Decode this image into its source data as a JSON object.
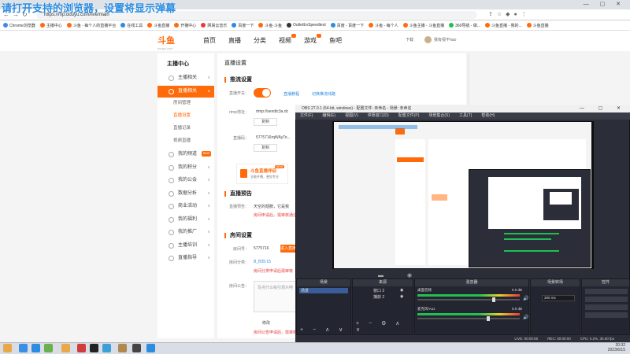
{
  "overlay": {
    "title": "请打开支持的浏览器，设置将显示弹幕"
  },
  "browser": {
    "url": "https://mp.douyu.com/live/main",
    "bookmarks": [
      "Chrome浏览器",
      "主播中心",
      "斗鱼 - 每个人的直播平台",
      "在线工具",
      "斗鱼直播",
      "开播中心",
      "网易云音乐",
      "百度一下",
      "斗鱼·斗鱼",
      "OutletEvSpeedtest",
      "百度 - 百度一下",
      "斗鱼 - 每个人",
      "斗鱼主播 - 斗鱼直播",
      "360导航 - 做...",
      "斗鱼直播 - 我的...",
      "斗鱼直播"
    ],
    "bookmark_colors": [
      "#4285f4",
      "#ff6b0a",
      "#ff6b0a",
      "#2b8ce0",
      "#ff6b0a",
      "#ff6b0a",
      "#e83b3b",
      "#2b8ce0",
      "#ff6b0a",
      "#333333",
      "#2b8ce0",
      "#ff6b0a",
      "#ff6b0a",
      "#1fc152",
      "#ff6b0a",
      "#ff6b0a"
    ]
  },
  "site": {
    "logo": "斗鱼",
    "logo_sub": "douyu.com",
    "nav": [
      "首页",
      "直播",
      "分类",
      "视频",
      "游戏",
      "鱼吧"
    ],
    "download": "下载",
    "username": "我有视不hao"
  },
  "sidebar": {
    "title": "主播中心",
    "items": [
      {
        "label": "主播相关"
      },
      {
        "label": "直播相关",
        "active": true
      },
      {
        "label": "我的频道"
      },
      {
        "label": "我的积分"
      },
      {
        "label": "我的公会"
      },
      {
        "label": "数据分析"
      },
      {
        "label": "商业活动"
      },
      {
        "label": "我的福利"
      },
      {
        "label": "我的推广"
      },
      {
        "label": "主播培训"
      },
      {
        "label": "直播指导"
      }
    ],
    "subitems": [
      "房间管理",
      "直播设置",
      "直播记录",
      "视频直播"
    ],
    "badge": "NEW"
  },
  "content": {
    "title": "直播设置",
    "push": {
      "section": "推流设置",
      "switch_label": "直播开关：",
      "help_link": "直播教程",
      "link2": "切换推流线路",
      "rtmp_label": "rtmp地址：",
      "rtmp_value": "rtmp://sendtc3a.dc",
      "code_label": "直播码：",
      "code_value": "5775716rqWAyTo...",
      "copy": "复制"
    },
    "promo": {
      "title": "斗鱼直播伴侣",
      "sub": "全能开播，更加专业",
      "badge": "NEW"
    },
    "notice": {
      "section": "直播预告",
      "label": "直播预告：",
      "value": "天空的翅膀，它是我",
      "warn": "房间申请后，需审核通过"
    },
    "room": {
      "section": "房间设置",
      "id_label": "房间号：",
      "id_value": "5775716",
      "enter": "进入直播间",
      "cat_label": "房间分类：",
      "cat_value": "B_B35:15",
      "cat_warn": "房间分类申请后需审核",
      "intro_label": "房间公告：",
      "intro_placeholder": "写点什么吸引观众吧",
      "edit": "修改",
      "intro_warn": "房间公告申请后，需审核"
    }
  },
  "obs": {
    "title": "OBS 27.0.1 (64-bit, windows) - 配置文件: 未命名 - 场景: 未命名",
    "menu": [
      "文件(F)",
      "编辑(E)",
      "视图(V)",
      "停靠窗口(D)",
      "配置文件(P)",
      "场景集合(S)",
      "工具(T)",
      "帮助(H)"
    ],
    "docks": {
      "scenes": {
        "title": "场景",
        "items": [
          "场景"
        ]
      },
      "sources": {
        "title": "来源",
        "items": [
          "窗口 2",
          "捕获 2"
        ]
      },
      "mixer": {
        "title": "混音器",
        "tracks": [
          {
            "name": "桌面音频",
            "db": "0.0 dB",
            "level": 0.75
          },
          {
            "name": "麦克风/Aux",
            "db": "0.0 dB",
            "level": 0.7
          }
        ]
      },
      "transitions": {
        "title": "场景转场",
        "duration": "300 ms"
      },
      "controls": {
        "title": "控件"
      }
    },
    "status": [
      "LIVE: 00:00:00",
      "REC: 00:00:00",
      "CPU: 0.2%, 30.00 fps"
    ]
  },
  "tray": {
    "time": "20:32",
    "date": "2023/6/15"
  },
  "taskbar_colors": [
    "#e8a84a",
    "#3a8ee6",
    "#2b8ce0",
    "#6ab04c",
    "#e8a84a",
    "#d23b3b",
    "#222222",
    "#3c9fd8",
    "#b08850",
    "#444444",
    "#2b8ce0"
  ]
}
